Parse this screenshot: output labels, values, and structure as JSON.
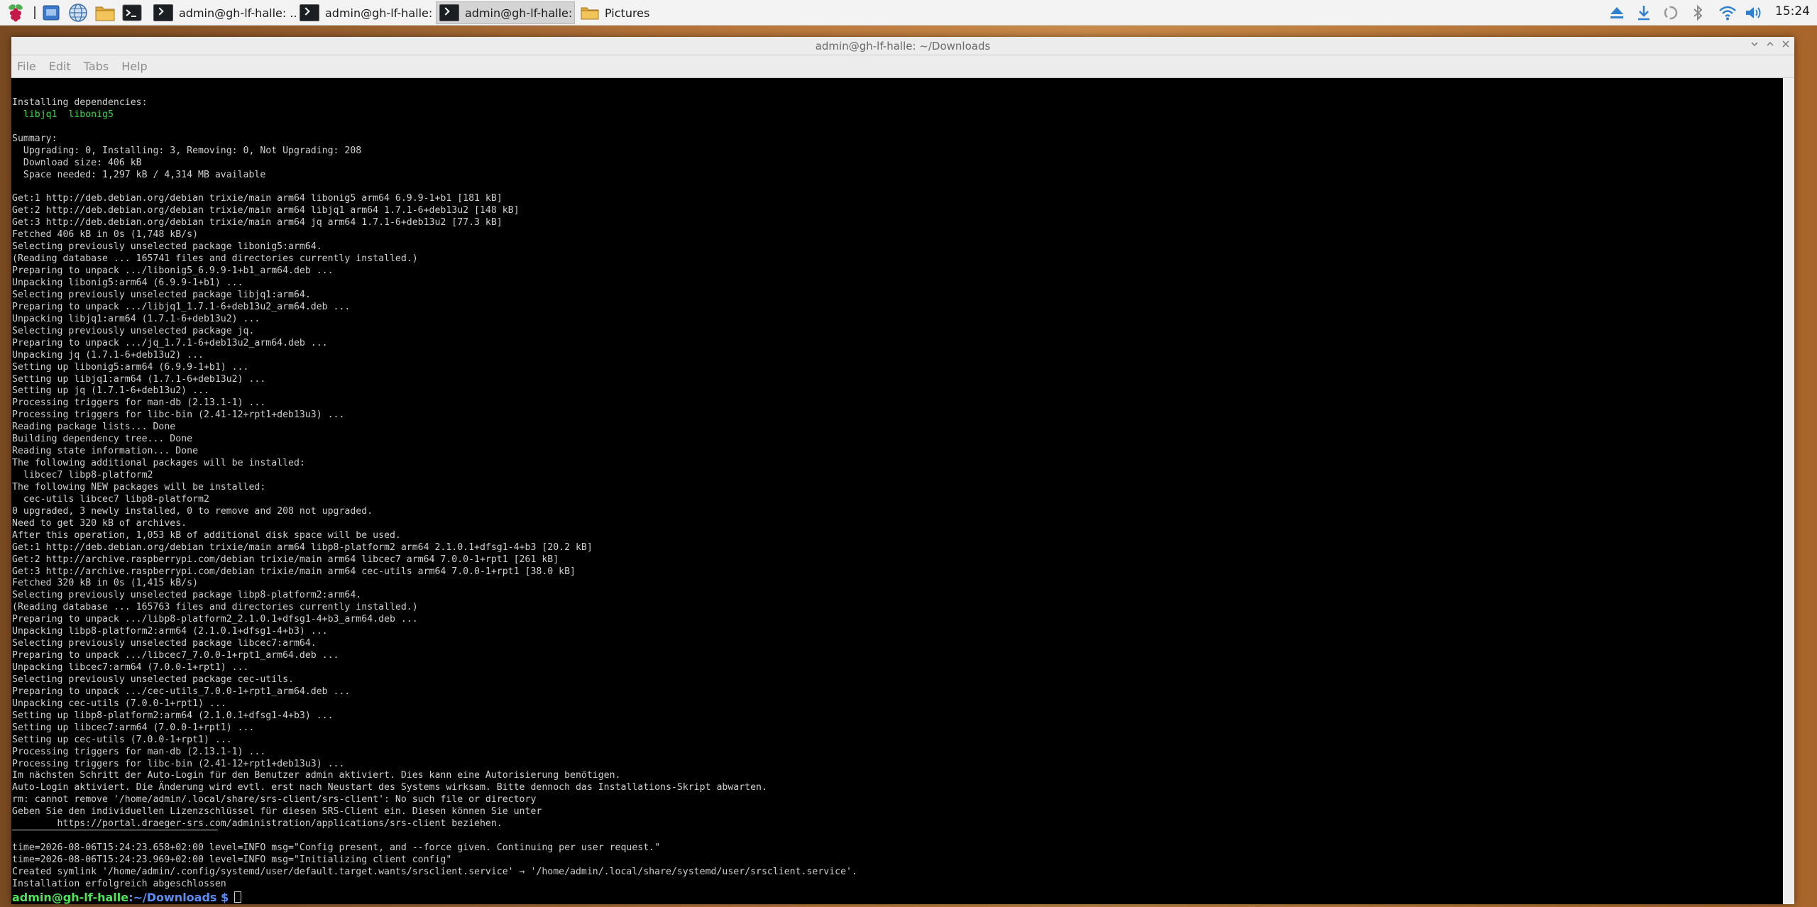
{
  "taskbar": {
    "tasks": [
      {
        "label": "admin@gh-lf-halle: ...",
        "active": false
      },
      {
        "label": "admin@gh-lf-halle: ~",
        "active": false
      },
      {
        "label": "admin@gh-lf-halle: ~",
        "active": true
      },
      {
        "label": "Pictures",
        "active": false
      }
    ],
    "clock": "15:24",
    "accent_color": "#c51a4a"
  },
  "window": {
    "title": "admin@gh-lf-halle: ~/Downloads",
    "menu": [
      "File",
      "Edit",
      "Tabs",
      "Help"
    ]
  },
  "terminal": {
    "lines": [
      "",
      "Installing dependencies:",
      "  libjq1  libonig5",
      "",
      "Summary:",
      "  Upgrading: 0, Installing: 3, Removing: 0, Not Upgrading: 208",
      "  Download size: 406 kB",
      "  Space needed: 1,297 kB / 4,314 MB available",
      "",
      "Get:1 http://deb.debian.org/debian trixie/main arm64 libonig5 arm64 6.9.9-1+b1 [181 kB]",
      "Get:2 http://deb.debian.org/debian trixie/main arm64 libjq1 arm64 1.7.1-6+deb13u2 [148 kB]",
      "Get:3 http://deb.debian.org/debian trixie/main arm64 jq arm64 1.7.1-6+deb13u2 [77.3 kB]",
      "Fetched 406 kB in 0s (1,748 kB/s)",
      "Selecting previously unselected package libonig5:arm64.",
      "(Reading database ... 165741 files and directories currently installed.)",
      "Preparing to unpack .../libonig5_6.9.9-1+b1_arm64.deb ...",
      "Unpacking libonig5:arm64 (6.9.9-1+b1) ...",
      "Selecting previously unselected package libjq1:arm64.",
      "Preparing to unpack .../libjq1_1.7.1-6+deb13u2_arm64.deb ...",
      "Unpacking libjq1:arm64 (1.7.1-6+deb13u2) ...",
      "Selecting previously unselected package jq.",
      "Preparing to unpack .../jq_1.7.1-6+deb13u2_arm64.deb ...",
      "Unpacking jq (1.7.1-6+deb13u2) ...",
      "Setting up libonig5:arm64 (6.9.9-1+b1) ...",
      "Setting up libjq1:arm64 (1.7.1-6+deb13u2) ...",
      "Setting up jq (1.7.1-6+deb13u2) ...",
      "Processing triggers for man-db (2.13.1-1) ...",
      "Processing triggers for libc-bin (2.41-12+rpt1+deb13u3) ...",
      "Reading package lists... Done",
      "Building dependency tree... Done",
      "Reading state information... Done",
      "The following additional packages will be installed:",
      "  libcec7 libp8-platform2",
      "The following NEW packages will be installed:",
      "  cec-utils libcec7 libp8-platform2",
      "0 upgraded, 3 newly installed, 0 to remove and 208 not upgraded.",
      "Need to get 320 kB of archives.",
      "After this operation, 1,053 kB of additional disk space will be used.",
      "Get:1 http://deb.debian.org/debian trixie/main arm64 libp8-platform2 arm64 2.1.0.1+dfsg1-4+b3 [20.2 kB]",
      "Get:2 http://archive.raspberrypi.com/debian trixie/main arm64 libcec7 arm64 7.0.0-1+rpt1 [261 kB]",
      "Get:3 http://archive.raspberrypi.com/debian trixie/main arm64 cec-utils arm64 7.0.0-1+rpt1 [38.0 kB]",
      "Fetched 320 kB in 0s (1,415 kB/s)",
      "Selecting previously unselected package libp8-platform2:arm64.",
      "(Reading database ... 165763 files and directories currently installed.)",
      "Preparing to unpack .../libp8-platform2_2.1.0.1+dfsg1-4+b3_arm64.deb ...",
      "Unpacking libp8-platform2:arm64 (2.1.0.1+dfsg1-4+b3) ...",
      "Selecting previously unselected package libcec7:arm64.",
      "Preparing to unpack .../libcec7_7.0.0-1+rpt1_arm64.deb ...",
      "Unpacking libcec7:arm64 (7.0.0-1+rpt1) ...",
      "Selecting previously unselected package cec-utils.",
      "Preparing to unpack .../cec-utils_7.0.0-1+rpt1_arm64.deb ...",
      "Unpacking cec-utils (7.0.0-1+rpt1) ...",
      "Setting up libp8-platform2:arm64 (2.1.0.1+dfsg1-4+b3) ...",
      "Setting up libcec7:arm64 (7.0.0-1+rpt1) ...",
      "Setting up cec-utils (7.0.0-1+rpt1) ...",
      "Processing triggers for man-db (2.13.1-1) ...",
      "Processing triggers for libc-bin (2.41-12+rpt1+deb13u3) ...",
      "Im nächsten Schritt der Auto-Login für den Benutzer admin aktiviert. Dies kann eine Autorisierung benötigen.",
      "Auto-Login aktiviert. Die Änderung wird evtl. erst nach Neustart des Systems wirksam. Bitte dennoch das Installations-Skript abwarten.",
      "rm: cannot remove '/home/admin/.local/share/srs-client/srs-client': No such file or directory",
      "Geben Sie den individuellen Lizenzschlüssel für diesen SRS-Client ein. Diesen können Sie unter",
      "        https://portal.draeger-srs.com/administration/applications/srs-client beziehen.",
      "",
      "time=2026-08-06T15:24:23.658+02:00 level=INFO msg=\"Config present, and --force given. Continuing per user request.\"",
      "time=2026-08-06T15:24:23.969+02:00 level=INFO msg=\"Initializing client config\"",
      "Created symlink '/home/admin/.config/systemd/user/default.target.wants/srsclient.service' → '/home/admin/.local/share/systemd/user/srsclient.service'.",
      "Installation erfolgreich abgeschlossen"
    ],
    "green_line_index": 2,
    "prompt_user": "admin@gh-lf-halle",
    "prompt_path": ":~/Downloads $ ",
    "colors": {
      "background": "#000000",
      "text": "#d0d0d0",
      "prompt_user": "#4fe35a",
      "prompt_path": "#5b8df2"
    }
  }
}
